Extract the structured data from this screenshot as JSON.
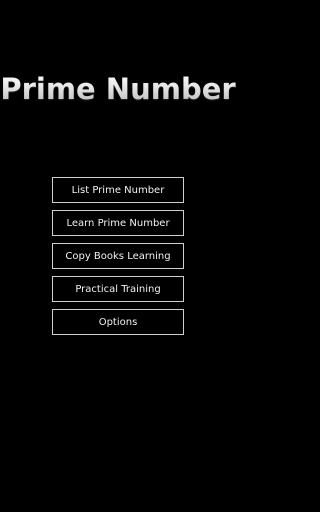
{
  "app": {
    "title": "Prime Number"
  },
  "menu": {
    "items": [
      {
        "label": "List Prime Number"
      },
      {
        "label": "Learn Prime Number"
      },
      {
        "label": "Copy Books Learning"
      },
      {
        "label": "Practical Training"
      },
      {
        "label": "Options"
      }
    ]
  },
  "colors": {
    "background": "#000000",
    "button_border": "#cfcfcf",
    "button_text": "#f2f2f2",
    "title": "#dcdcdc"
  }
}
